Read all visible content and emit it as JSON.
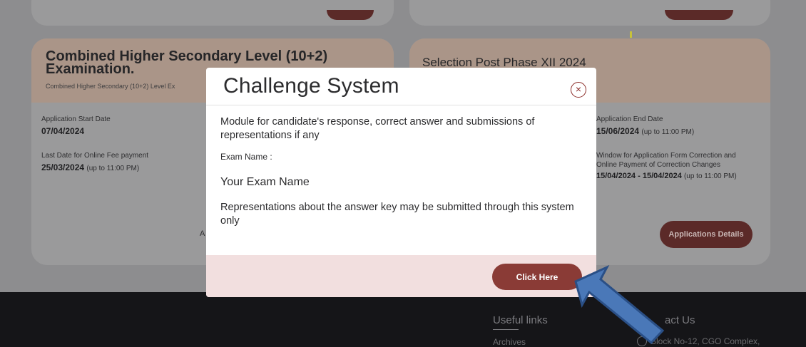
{
  "cards": {
    "left": {
      "title_line1": "Combined Higher Secondary Level (10+2)",
      "title_line2": "Examination.",
      "subtitle": "Combined Higher Secondary (10+2) Level Ex",
      "start_label": "Application Start Date",
      "start_value": "07/04/2024",
      "fee_label": "Last Date for Online Fee payment",
      "fee_value": "25/03/2024",
      "fee_time": "(up to 11:00 PM)",
      "partial_text": "A"
    },
    "right": {
      "title": "Selection Post Phase XII 2024",
      "end_label": "Application End Date",
      "end_value": "15/06/2024",
      "end_time": "(up to 11:00 PM)",
      "window_label_line1": "Window for Application Form Correction and",
      "window_label_line2": "Online Payment of Correction Changes",
      "window_value": "15/04/2024 - 15/04/2024",
      "window_time": "(up to 11:00 PM)",
      "details_button": "Applications Details"
    }
  },
  "footer": {
    "useful_links": "Useful links",
    "archives": "Archives",
    "contact_partial": "act Us",
    "address_partial": "Block No-12, CGO Complex,"
  },
  "modal": {
    "title": "Challenge System",
    "close_icon": "×",
    "description": "Module for candidate's response, correct answer and submissions of representations if any",
    "exam_label": "Exam Name :",
    "exam_name": "Your Exam Name",
    "note": "Representations about the answer key may be submitted through this system only",
    "button_label": "Click Here"
  },
  "colors": {
    "accent": "#8a3b36",
    "modal_footer": "#f2dfdf",
    "arrow_fill": "#4a78b8"
  }
}
